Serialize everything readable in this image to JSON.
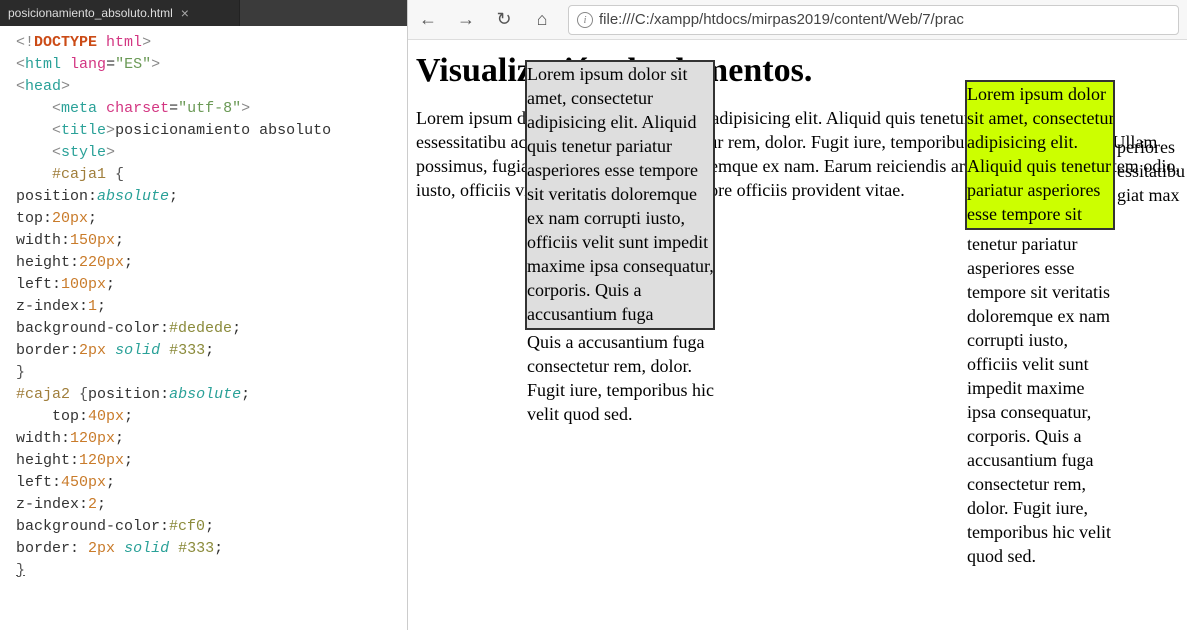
{
  "editor": {
    "tab": {
      "filename": "posicionamiento_absoluto.html",
      "close": "×"
    },
    "code_lines": [
      {
        "html": "<span class='c-ang'>&lt;!</span><span class='c-doctype'>DOCTYPE</span> <span class='c-attr'>html</span><span class='c-ang'>&gt;</span>"
      },
      {
        "html": "<span class='c-ang'>&lt;</span><span class='c-tag'>html</span> <span class='c-attr'>lang</span>=<span class='c-str'>\"ES\"</span><span class='c-ang'>&gt;</span>"
      },
      {
        "html": "<span class='c-ang'>&lt;</span><span class='c-tag'>head</span><span class='c-ang'>&gt;</span>"
      },
      {
        "html": "    <span class='c-ang'>&lt;</span><span class='c-tag'>meta</span> <span class='c-attr'>charset</span>=<span class='c-str'>\"utf-8\"</span><span class='c-ang'>&gt;</span>"
      },
      {
        "html": "    <span class='c-ang'>&lt;</span><span class='c-tag'>title</span><span class='c-ang'>&gt;</span><span class='c-title'>posicionamiento absoluto</span>"
      },
      {
        "html": "    <span class='c-ang'>&lt;</span><span class='c-tag'>style</span><span class='c-ang'>&gt;</span>"
      },
      {
        "html": "    <span class='c-sel'>#caja1</span> <span class='c-brace'>{</span>"
      },
      {
        "html": "<span class='c-prop'>position</span>:<span class='c-ital'>absolute</span>;"
      },
      {
        "html": "<span class='c-prop'>top</span>:<span class='c-val'>20px</span>;"
      },
      {
        "html": "<span class='c-prop'>width</span>:<span class='c-val'>150px</span>;"
      },
      {
        "html": "<span class='c-prop'>height</span>:<span class='c-val'>220px</span>;"
      },
      {
        "html": "<span class='c-prop'>left</span>:<span class='c-val'>100px</span>;"
      },
      {
        "html": "<span class='c-prop'>z-index</span>:<span class='c-val'>1</span>;"
      },
      {
        "html": "<span class='c-prop'>background-color</span>:<span class='c-hex'>#dedede</span>;"
      },
      {
        "html": "<span class='c-prop'>border</span>:<span class='c-val'>2px</span> <span class='c-ital'>solid</span> <span class='c-hex'>#333</span>;"
      },
      {
        "html": "<span class='c-brace'>}</span>"
      },
      {
        "html": "<span class='c-sel'>#caja2</span> <span class='c-brace'>{</span><span class='c-prop'>position</span>:<span class='c-ital'>absolute</span>;"
      },
      {
        "html": "    <span class='c-prop'>top</span>:<span class='c-val'>40px</span>;"
      },
      {
        "html": "<span class='c-prop'>width</span>:<span class='c-val'>120px</span>;"
      },
      {
        "html": "<span class='c-prop'>height</span>:<span class='c-val'>120px</span>;"
      },
      {
        "html": "<span class='c-prop'>left</span>:<span class='c-val'>450px</span>;"
      },
      {
        "html": "<span class='c-prop'>z-index</span>:<span class='c-val'>2</span>;"
      },
      {
        "html": "<span class='c-prop'>background-color</span>:<span class='c-hex'>#cf0</span>;"
      },
      {
        "html": "<span class='c-prop'>border</span>: <span class='c-val'>2px</span> <span class='c-ital'>solid</span> <span class='c-hex'>#333</span>;"
      },
      {
        "html": "<span class='c-brace' style='text-decoration:underline'>}</span>"
      }
    ]
  },
  "browser": {
    "nav": {
      "back": "←",
      "forward": "→",
      "reload": "↻",
      "home": "⌂"
    },
    "url": "file:///C:/xampp/htdocs/mirpas2019/content/Web/7/prac",
    "page": {
      "h1": "Visualización de elementos.",
      "p": "Lorem ipsum dolor sit amet, consectetur adipisicing elit. Aliquid quis tenetur pariatur asperiores essessitatibu accusantium fuga consectetur rem, dolor. Fugit iure, temporibus hic velit quod sed. Ullam possimus, fugiat max nostrum et, a doloremque ex nam. Earum reiciendis architecto non voluptatem odio, iusto, officiis vitae. Aperiam cumque labore officiis provident vitae.",
      "lorem_full": "Lorem ipsum dolor sit amet, consectetur adipisicing elit. Aliquid quis tenetur pariatur asperiores esse tempore sit veritatis doloremque ex nam corrupti iusto, officiis velit sunt impedit maxime ipsa consequatur, corporis. Quis a accusantium fuga consectetur rem, dolor. Fugit iure, temporibus hic velit quod sed.",
      "behind_right": "periores \nessitatibu\ngiat max"
    }
  }
}
